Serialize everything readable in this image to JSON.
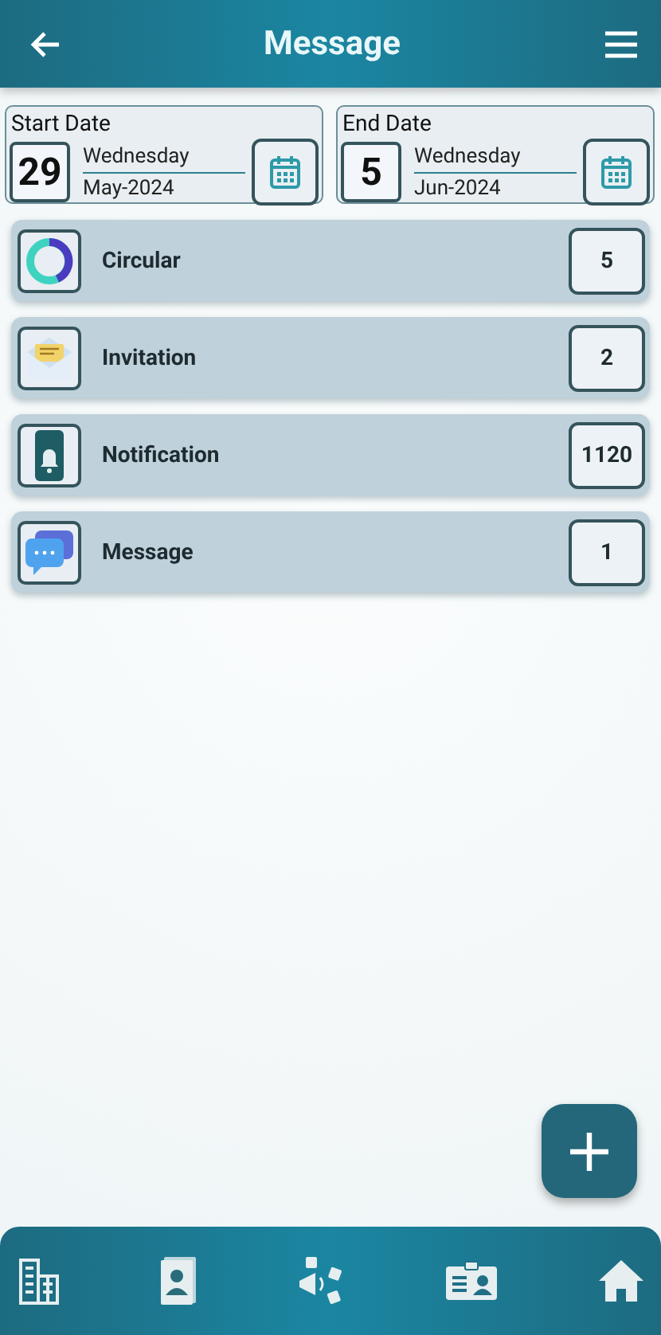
{
  "header": {
    "title": "Message"
  },
  "dates": [
    {
      "label": "Start Date",
      "day": "29",
      "weekday": "Wednesday",
      "month_year": "May-2024"
    },
    {
      "label": "End Date",
      "day": "5",
      "weekday": "Wednesday",
      "month_year": "Jun-2024"
    }
  ],
  "categories": [
    {
      "kind": "circular",
      "label": "Circular",
      "count": "5"
    },
    {
      "kind": "invitation",
      "label": "Invitation",
      "count": "2"
    },
    {
      "kind": "notification",
      "label": "Notification",
      "count": "1120"
    },
    {
      "kind": "message",
      "label": "Message",
      "count": "1"
    }
  ]
}
